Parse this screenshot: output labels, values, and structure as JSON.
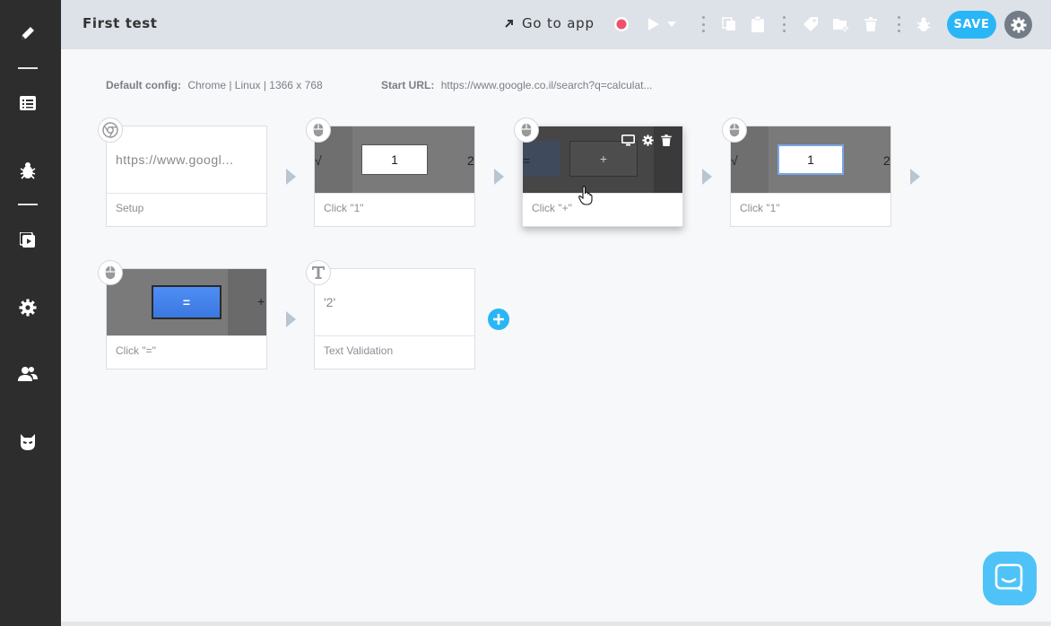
{
  "header": {
    "title": "First test",
    "goto_label": "Go to app",
    "save_label": "SAVE"
  },
  "config": {
    "default_label": "Default config:",
    "default_value": "Chrome | Linux | 1366 x 768",
    "start_label": "Start URL:",
    "start_value": "https://www.google.co.il/search?q=calculat..."
  },
  "steps": [
    {
      "label": "Setup",
      "thumb_text": "https://www.googl...",
      "icon": "chrome-icon"
    },
    {
      "label": "Click \"1\"",
      "key": "1",
      "left_glyph": "√",
      "right_glyph": "2",
      "icon": "mouse-icon"
    },
    {
      "label": "Click \"+\"",
      "key": "+",
      "left_glyph": "=",
      "icon": "mouse-icon"
    },
    {
      "label": "Click \"1\"",
      "key": "1",
      "left_glyph": "√",
      "right_glyph": "2",
      "icon": "mouse-icon"
    },
    {
      "label": "Click \"=\"",
      "key": "=",
      "right_glyph": "+",
      "icon": "mouse-icon"
    },
    {
      "label": "Text Validation",
      "thumb_text": "'2'",
      "icon": "text-t-icon"
    }
  ],
  "colors": {
    "sidebar": "#2d2d2d",
    "topbar": "#dde1e8",
    "accent": "#29b6f6",
    "record": "#f0506e",
    "arrow": "#b8c5d2"
  }
}
